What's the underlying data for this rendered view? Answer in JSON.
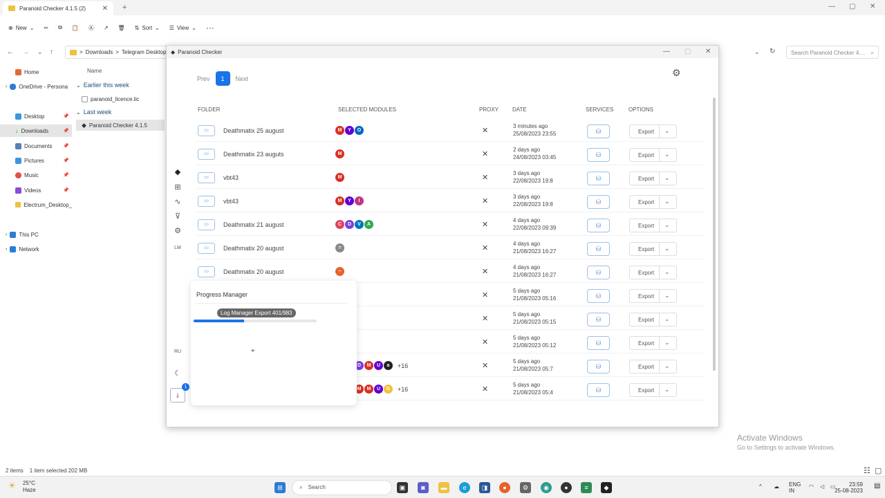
{
  "explorer": {
    "tab_title": "Paranoid Checker 4.1.5 (2)",
    "new_tab": "+",
    "toolbar": {
      "new": "New",
      "sort": "Sort",
      "view": "View",
      "more": "···"
    },
    "breadcrumb": {
      "seg1": "Downloads",
      "sep": ">",
      "seg2": "Telegram Desktop"
    },
    "search_placeholder": "Search Paranoid Checker 4....",
    "nav": [
      {
        "label": "Home"
      },
      {
        "label": "OneDrive - Persona"
      },
      {
        "label": "Desktop"
      },
      {
        "label": "Downloads"
      },
      {
        "label": "Documents"
      },
      {
        "label": "Pictures"
      },
      {
        "label": "Music"
      },
      {
        "label": "Videos"
      },
      {
        "label": "Electrum_Desktop_"
      },
      {
        "label": "This PC"
      },
      {
        "label": "Network"
      }
    ],
    "col_name": "Name",
    "group1": "Earlier this week",
    "file1": "paranoid_licence.lic",
    "group2": "Last week",
    "file2": "Paranoid Checker 4.1.5",
    "status_items": "2 items",
    "status_selected": "1 item selected  202 MB",
    "activate_title": "Activate Windows",
    "activate_sub": "Go to Settings to activate Windows."
  },
  "app": {
    "title": "Paranoid Checker",
    "pager": {
      "prev": "Prev",
      "page": "1",
      "next": "Next"
    },
    "sidebar": {
      "lang": "RU",
      "lm": "LM",
      "download_badge": "1"
    },
    "columns": {
      "folder": "FOLDER",
      "modules": "SELECTED MODULES",
      "proxy": "PROXY",
      "date": "DATE",
      "services": "SERVICES",
      "options": "OPTIONS"
    },
    "export_label": "Export",
    "rows": [
      {
        "folder": "Deathmatix 25 august",
        "rel": "3 minutes ago",
        "abs": "25/08/2023 23:55",
        "extra": ""
      },
      {
        "folder": "Deathmatix 23 auguts",
        "rel": "2 days ago",
        "abs": "24/08/2023 03:45",
        "extra": ""
      },
      {
        "folder": "vbt43",
        "rel": "3 days ago",
        "abs": "22/08/2023 19:8",
        "extra": ""
      },
      {
        "folder": "vbt43",
        "rel": "3 days ago",
        "abs": "22/08/2023 19:8",
        "extra": ""
      },
      {
        "folder": "Deathmatix 21 august",
        "rel": "4 days ago",
        "abs": "22/08/2023 09:39",
        "extra": ""
      },
      {
        "folder": "Deathmatix 20 august",
        "rel": "4 days ago",
        "abs": "21/08/2023 16:27",
        "extra": ""
      },
      {
        "folder": "Deathmatix 20 august",
        "rel": "4 days ago",
        "abs": "21/08/2023 16:27",
        "extra": ""
      },
      {
        "folder": "",
        "rel": "5 days ago",
        "abs": "21/08/2023 05:16",
        "extra": ""
      },
      {
        "folder": "",
        "rel": "5 days ago",
        "abs": "21/08/2023 05:15",
        "extra": ""
      },
      {
        "folder": "",
        "rel": "5 days ago",
        "abs": "21/08/2023 05:12",
        "extra": ""
      },
      {
        "folder": "",
        "rel": "5 days ago",
        "abs": "21/08/2023 05:7",
        "extra": "+16"
      },
      {
        "folder": "",
        "rel": "5 days ago",
        "abs": "21/08/2023 05:4",
        "extra": "+16"
      }
    ],
    "progress": {
      "title": "Progress Manager",
      "label": "Log Manager Export 401/983",
      "done": 401,
      "total": 983
    }
  },
  "taskbar": {
    "temp": "25°C",
    "weather": "Haze",
    "search": "Search",
    "lang1": "ENG",
    "lang2": "IN",
    "time": "23:59",
    "date": "25-08-2023"
  }
}
